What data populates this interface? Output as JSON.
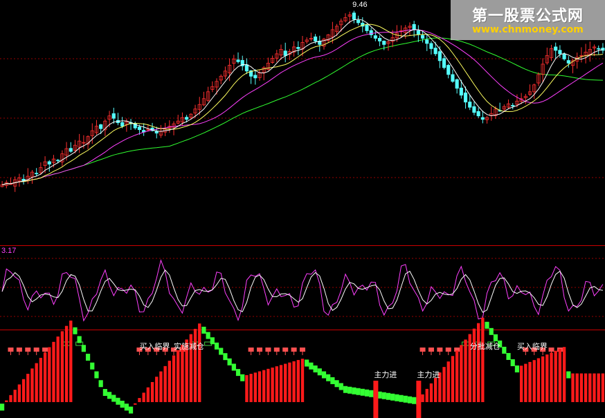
{
  "watermark": {
    "title": "第一股票公式网",
    "url": "www.chnmoney.com"
  },
  "colors": {
    "up": "#ff3030",
    "down": "#55ffff",
    "ma5": "#ffffff",
    "ma10": "#ffff60",
    "ma20": "#ff40ff",
    "ma60": "#30ff30",
    "grid": "#990000",
    "osc_fast": "#ff40ff",
    "osc_slow": "#ffffff",
    "bar_up": "#ff1a1a",
    "bar_down": "#33ff33",
    "signal_label": "#ffffff",
    "buy_marker": "#ff5050",
    "box_marker": "#40d040",
    "osc_label": "#ff40ff"
  },
  "chart_data": [
    {
      "type": "candlestick",
      "title": "",
      "peak_label": "9.46",
      "ylabel": "",
      "series_lines": [
        "MA5",
        "MA10",
        "MA20",
        "MA60"
      ],
      "close": [
        4.35,
        4.42,
        4.38,
        4.5,
        4.55,
        4.47,
        4.6,
        4.72,
        4.68,
        4.85,
        5.02,
        4.95,
        5.1,
        5.05,
        5.25,
        5.4,
        5.32,
        5.5,
        5.62,
        5.58,
        5.75,
        5.92,
        6.05,
        5.98,
        6.2,
        6.35,
        6.28,
        6.15,
        6.05,
        6.18,
        6.12,
        6.0,
        5.95,
        5.88,
        5.96,
        5.92,
        5.85,
        5.9,
        5.98,
        6.05,
        6.12,
        6.2,
        6.3,
        6.25,
        6.4,
        6.55,
        6.68,
        6.85,
        7.05,
        7.2,
        7.35,
        7.5,
        7.65,
        7.82,
        8.0,
        7.92,
        7.8,
        7.65,
        7.5,
        7.45,
        7.6,
        7.75,
        7.88,
        8.02,
        8.15,
        8.28,
        8.1,
        8.22,
        8.35,
        8.3,
        8.48,
        8.55,
        8.6,
        8.52,
        8.42,
        8.58,
        8.7,
        8.85,
        8.95,
        9.1,
        9.2,
        9.28,
        9.15,
        9.05,
        8.95,
        8.82,
        8.7,
        8.6,
        8.52,
        8.42,
        8.5,
        8.62,
        8.75,
        8.82,
        8.9,
        8.95,
        8.85,
        8.72,
        8.6,
        8.45,
        8.3,
        8.15,
        7.95,
        7.75,
        7.55,
        7.35,
        7.15,
        6.95,
        6.75,
        6.6,
        6.45,
        6.35,
        6.25,
        6.3,
        6.42,
        6.55,
        6.5,
        6.62,
        6.7,
        6.65,
        6.78,
        6.85,
        6.92,
        7.05,
        7.25,
        7.55,
        7.85,
        8.1,
        8.3,
        8.25,
        8.15,
        8.0,
        7.88,
        7.95,
        8.05,
        8.1,
        8.2,
        8.28,
        8.35,
        8.3,
        8.25
      ],
      "ylim": [
        3.7,
        9.55
      ]
    },
    {
      "type": "line",
      "label": "3.17",
      "series": [
        {
          "name": "",
          "role": "fast"
        },
        {
          "name": "",
          "role": "slow"
        }
      ],
      "ylim": [
        0,
        100
      ]
    },
    {
      "type": "bar",
      "annotations": [
        {
          "text": "买入临界",
          "bar": 32
        },
        {
          "text": "实施减仓",
          "bar": 40
        },
        {
          "text": "分批减仓",
          "bar": 109
        },
        {
          "text": "买入临界",
          "bar": 120
        }
      ],
      "main_force": [
        {
          "text": "主力进",
          "bar": 87
        },
        {
          "text": "主力进",
          "bar": 97
        }
      ],
      "trend": [
        {
          "from": 0,
          "to": 16,
          "start": -0.55,
          "end": 0.9
        },
        {
          "from": 16,
          "to": 24,
          "start": 0.9,
          "end": -0.3
        },
        {
          "from": 24,
          "to": 30,
          "start": -0.3,
          "end": -0.6
        },
        {
          "from": 30,
          "to": 46,
          "start": -0.6,
          "end": 0.85
        },
        {
          "from": 46,
          "to": 56,
          "start": 0.85,
          "end": -0.05
        },
        {
          "from": 56,
          "to": 70,
          "start": -0.05,
          "end": 0.25
        },
        {
          "from": 70,
          "to": 80,
          "start": 0.25,
          "end": -0.25
        },
        {
          "from": 80,
          "to": 97,
          "start": -0.25,
          "end": -0.45
        },
        {
          "from": 97,
          "to": 112,
          "start": -0.45,
          "end": 0.95
        },
        {
          "from": 112,
          "to": 120,
          "start": 0.95,
          "end": 0.1
        },
        {
          "from": 120,
          "to": 131,
          "start": 0.1,
          "end": 0.45
        }
      ]
    }
  ]
}
